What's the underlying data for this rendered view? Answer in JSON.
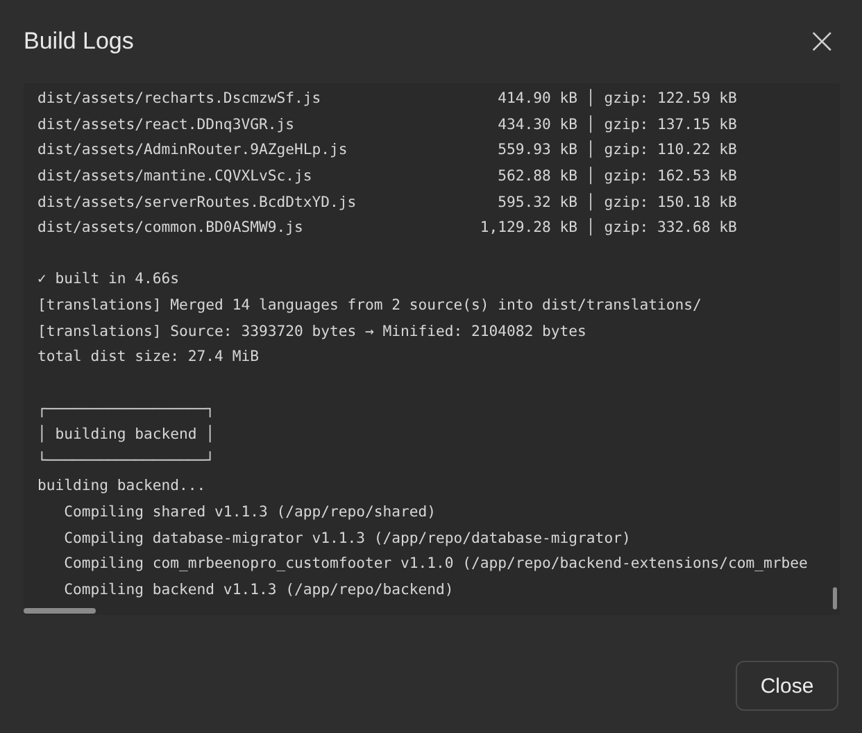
{
  "dialog": {
    "title": "Build Logs",
    "close_icon": "×"
  },
  "log": {
    "lines": [
      {
        "kind": "text",
        "text": "dist/assets/recharts.DscmzwSf.js                    414.90 kB │ gzip: 122.59 kB"
      },
      {
        "kind": "text",
        "text": "dist/assets/react.DDnq3VGR.js                       434.30 kB │ gzip: 137.15 kB"
      },
      {
        "kind": "text",
        "text": "dist/assets/AdminRouter.9AZgeHLp.js                 559.93 kB │ gzip: 110.22 kB"
      },
      {
        "kind": "text",
        "text": "dist/assets/mantine.CQVXLvSc.js                     562.88 kB │ gzip: 162.53 kB"
      },
      {
        "kind": "text",
        "text": "dist/assets/serverRoutes.BcdDtxYD.js                595.32 kB │ gzip: 150.18 kB"
      },
      {
        "kind": "text",
        "text": "dist/assets/common.BD0ASMW9.js                    1,129.28 kB │ gzip: 332.68 kB"
      },
      {
        "kind": "gap"
      },
      {
        "kind": "text",
        "text": "✓ built in 4.66s"
      },
      {
        "kind": "text",
        "text": "[translations] Merged 14 languages from 2 source(s) into dist/translations/"
      },
      {
        "kind": "text",
        "text": "[translations] Source: 3393720 bytes → Minified: 2104082 bytes"
      },
      {
        "kind": "text",
        "text": "total dist size: 27.4 MiB"
      },
      {
        "kind": "gap"
      },
      {
        "kind": "text",
        "text": "┌──────────────────┐"
      },
      {
        "kind": "text",
        "text": "│ building backend │"
      },
      {
        "kind": "text",
        "text": "└──────────────────┘"
      },
      {
        "kind": "text",
        "text": "building backend..."
      },
      {
        "kind": "text",
        "text": "   Compiling shared v1.1.3 (/app/repo/shared)"
      },
      {
        "kind": "text",
        "text": "   Compiling database-migrator v1.1.3 (/app/repo/database-migrator)"
      },
      {
        "kind": "text",
        "text": "   Compiling com_mrbeenopro_customfooter v1.1.0 (/app/repo/backend-extensions/com_mrbee"
      },
      {
        "kind": "text",
        "text": "   Compiling backend v1.1.3 (/app/repo/backend)"
      }
    ]
  },
  "buttons": [
    {
      "label": "Close"
    }
  ]
}
